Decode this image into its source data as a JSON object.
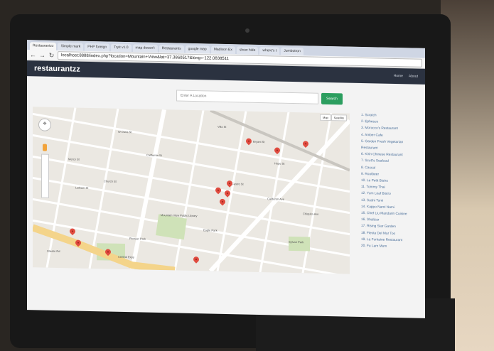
{
  "browser": {
    "tabs": [
      "Restaurantzz",
      "Simple mark",
      "PHP foreign",
      "Tryit v1.0",
      "map doesn't",
      "Restaurants",
      "google map",
      "Madison Ex",
      "show hide",
      "where's t",
      "Jumbotron"
    ],
    "url": "localhost:8888/index.php?location=Mountain+View&lat=37.3860517&long=-122.0838511"
  },
  "nav": {
    "brand": "restaurantzz",
    "links": [
      "Home",
      "About"
    ]
  },
  "search": {
    "placeholder": "Enter A Location",
    "button": "Search"
  },
  "map": {
    "type_buttons": [
      "Map",
      "Satellite"
    ],
    "street_labels": [
      "W Dana St",
      "Villa St",
      "Mercy St",
      "California St",
      "Latham St",
      "Church St",
      "Mountain View Public Library",
      "Eagle Park",
      "Pioneer Park",
      "Central Expy",
      "Castro St",
      "Bryant St",
      "Hope St",
      "Calderon Ave",
      "Sylvan Park",
      "Chiquita Ave",
      "Stierlin Rd"
    ],
    "marker_count": 11
  },
  "restaurants": [
    "1. Scratch",
    "2. Ephesus",
    "3. Morocco's Restaurant",
    "4. Amber Cafe",
    "5. Garden Fresh Vegetarian",
    "Restaurant",
    "6. Kirin Chinese Restaurant",
    "7. Scott's Seafood",
    "8. Cascal",
    "9. Rootbeer",
    "10. Le Petit Bistro",
    "11. Tommy Thai",
    "12. Yum Leaf Bistro",
    "13. Sushi Tomi",
    "14. Kappo Nami Nami",
    "15. Chef Liu Mandarin Cuisine",
    "16. Shalizar",
    "17. Rising Star Garden",
    "18. Fiesta Del Mar Too",
    "19. La Fontaine Restaurant",
    "20. Fu Lam Mum"
  ]
}
